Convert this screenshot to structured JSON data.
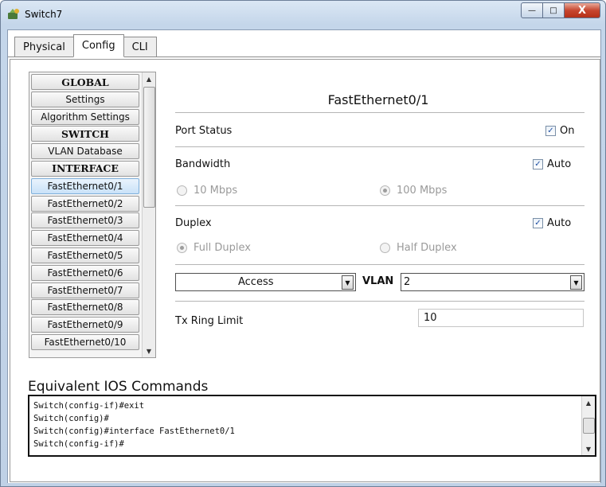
{
  "window": {
    "title": "Switch7",
    "min_glyph": "—",
    "max_glyph": "□",
    "close_glyph": "X"
  },
  "tabs": [
    {
      "label": "Physical"
    },
    {
      "label": "Config"
    },
    {
      "label": "CLI"
    }
  ],
  "sidebar": {
    "items": [
      {
        "label": "GLOBAL",
        "type": "header"
      },
      {
        "label": "Settings"
      },
      {
        "label": "Algorithm Settings"
      },
      {
        "label": "SWITCH",
        "type": "header"
      },
      {
        "label": "VLAN Database"
      },
      {
        "label": "INTERFACE",
        "type": "header"
      },
      {
        "label": "FastEthernet0/1",
        "selected": true
      },
      {
        "label": "FastEthernet0/2"
      },
      {
        "label": "FastEthernet0/3"
      },
      {
        "label": "FastEthernet0/4"
      },
      {
        "label": "FastEthernet0/5"
      },
      {
        "label": "FastEthernet0/6"
      },
      {
        "label": "FastEthernet0/7"
      },
      {
        "label": "FastEthernet0/8"
      },
      {
        "label": "FastEthernet0/9"
      },
      {
        "label": "FastEthernet0/10"
      }
    ]
  },
  "port": {
    "title": "FastEthernet0/1",
    "port_status_label": "Port Status",
    "port_status_on_label": "On",
    "bandwidth_label": "Bandwidth",
    "bandwidth_auto_label": "Auto",
    "bw_10": "10 Mbps",
    "bw_100": "100 Mbps",
    "duplex_label": "Duplex",
    "duplex_auto_label": "Auto",
    "full_duplex": "Full Duplex",
    "half_duplex": "Half Duplex",
    "mode_value": "Access",
    "vlan_label": "VLAN",
    "vlan_value": "2",
    "tx_ring_label": "Tx Ring Limit",
    "tx_ring_value": "10"
  },
  "ios": {
    "title": "Equivalent IOS Commands",
    "lines": "Switch(config-if)#exit\nSwitch(config)#\nSwitch(config)#interface FastEthernet0/1\nSwitch(config-if)#"
  }
}
